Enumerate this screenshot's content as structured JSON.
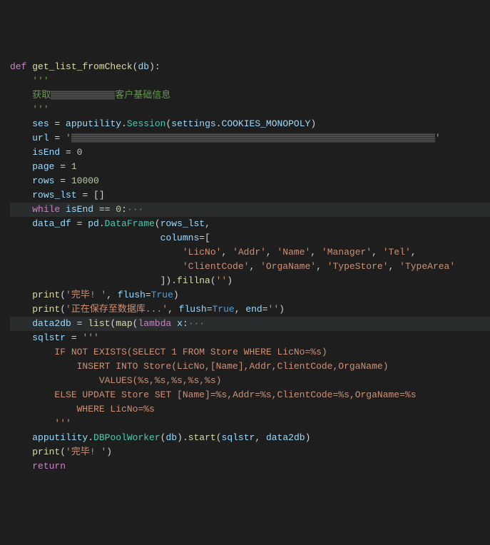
{
  "code": {
    "def_kw": "def",
    "func_name": "get_list_fromCheck",
    "param": "db",
    "docq": "'''",
    "doc_pre": "获取",
    "doc_post": "客户基础信息",
    "ses_var": "ses",
    "eq": " = ",
    "apputility": "apputility",
    "session": "Session",
    "settings": "settings",
    "cookies": "COOKIES_MONOPOLY",
    "url_var": "url",
    "url_open": "'",
    "url_close": "'",
    "isEnd_var": "isEnd",
    "zero": "0",
    "page_var": "page",
    "one": "1",
    "rows_var": "rows",
    "rows_val": "10000",
    "rows_lst_var": "rows_lst",
    "empty_list": "[]",
    "while_kw": "while",
    "while_cond_var": "isEnd",
    "while_cond_op": " == ",
    "while_cond_val": "0",
    "fold": "···",
    "data_df_var": "data_df",
    "pd": "pd",
    "dataframe": "DataFrame",
    "rows_lst_ref": "rows_lst",
    "columns_kw": "columns",
    "col1": "'LicNo'",
    "col2": "'Addr'",
    "col3": "'Name'",
    "col4": "'Manager'",
    "col5": "'Tel'",
    "col6": "'ClientCode'",
    "col7": "'OrgaName'",
    "col8": "'TypeStore'",
    "col9": "'TypeArea'",
    "fillna": "fillna",
    "empty_str": "''",
    "print": "print",
    "done_str": "'完毕! '",
    "flush_kw": "flush",
    "true": "True",
    "saving_str": "'正在保存至数据库...'",
    "end_kw": "end",
    "data2db_var": "data2db",
    "list": "list",
    "map": "map",
    "lambda": "lambda",
    "x": "x",
    "sqlstr_var": "sqlstr",
    "sql_open": "'''",
    "sql1": "IF NOT EXISTS(SELECT 1 FROM Store WHERE LicNo=%s)",
    "sql2": "INSERT INTO Store(LicNo,[Name],Addr,ClientCode,OrgaName)",
    "sql3": "VALUES(%s,%s,%s,%s,%s)",
    "sql4": "ELSE UPDATE Store SET [Name]=%s,Addr=%s,ClientCode=%s,OrgaName=%s",
    "sql5": "WHERE LicNo=%s",
    "sql_close": "'''",
    "dbpool": "DBPoolWorker",
    "start": "start",
    "done2": "'完毕! '",
    "return_kw": "return"
  }
}
